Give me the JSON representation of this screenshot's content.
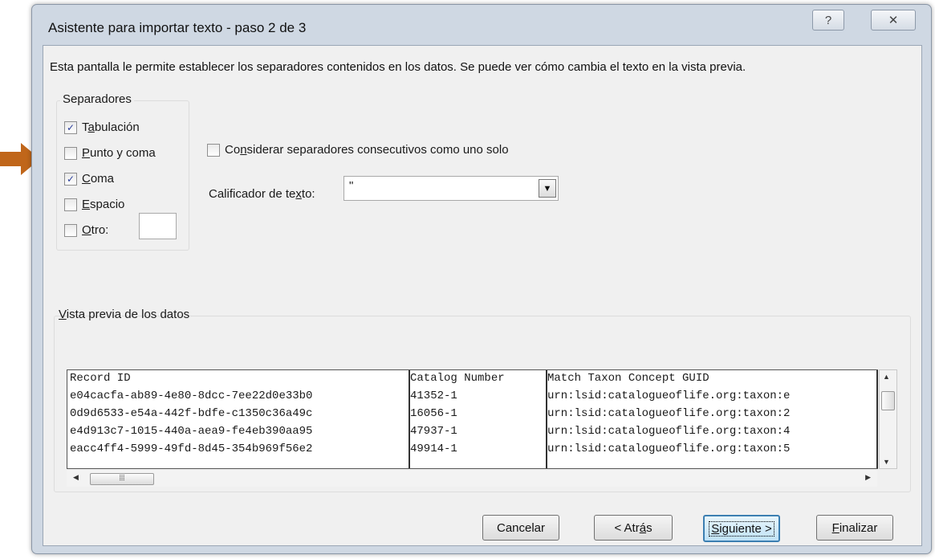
{
  "window": {
    "title": "Asistente para importar texto - paso 2 de 3",
    "help_label": "?",
    "close_label": "✕"
  },
  "description": "Esta pantalla le permite establecer los separadores contenidos en los datos. Se puede ver cómo cambia el texto en la vista previa.",
  "separators": {
    "label": "Separadores",
    "tab": {
      "label": "Tabulación",
      "checked": true
    },
    "semicolon": {
      "label": "Punto y coma",
      "checked": false
    },
    "comma": {
      "label": "Coma",
      "checked": true
    },
    "space": {
      "label": "Espacio",
      "checked": false
    },
    "other": {
      "label": "Otro:",
      "checked": false,
      "value": ""
    }
  },
  "consecutive": {
    "label": "Considerar separadores consecutivos como uno solo",
    "checked": false
  },
  "qualifier": {
    "label": "Calificador de texto:",
    "value": "\""
  },
  "preview": {
    "label": "Vista previa de los datos",
    "columns": [
      {
        "header": "Record ID",
        "cells": [
          "e04cacfa-ab89-4e80-8dcc-7ee22d0e33b0",
          "0d9d6533-e54a-442f-bdfe-c1350c36a49c",
          "e4d913c7-1015-440a-aea9-fe4eb390aa95",
          "eacc4ff4-5999-49fd-8d45-354b969f56e2"
        ]
      },
      {
        "header": "Catalog Number",
        "cells": [
          "41352-1",
          "16056-1",
          "47937-1",
          "49914-1"
        ]
      },
      {
        "header": "Match Taxon Concept GUID",
        "cells": [
          "urn:lsid:catalogueoflife.org:taxon:e",
          "urn:lsid:catalogueoflife.org:taxon:2",
          "urn:lsid:catalogueoflife.org:taxon:4",
          "urn:lsid:catalogueoflife.org:taxon:5"
        ]
      }
    ]
  },
  "buttons": {
    "cancel": "Cancelar",
    "back": "< Atrás",
    "next": "Siguiente >",
    "finish": "Finalizar"
  },
  "colors": {
    "annotation_arrow": "#c0661a",
    "default_button_border": "#3c7fb1"
  }
}
